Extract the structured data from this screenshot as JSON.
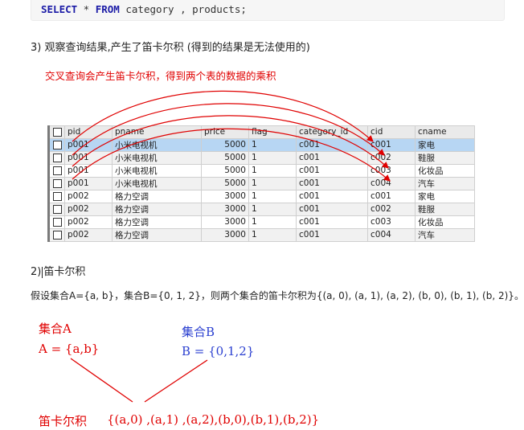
{
  "code": {
    "kw1": "SELECT",
    "mid1": " * ",
    "kw2": "FROM",
    "rest": " category , products;"
  },
  "section3_heading": "3) 观察查询结果,产生了笛卡尔积 (得到的结果是无法使用的)",
  "annotation": "交叉查询会产生笛卡尔积，得到两个表的数据的乘积",
  "table": {
    "columns": [
      "pid",
      "pname",
      "price",
      "flag",
      "category_id",
      "cid",
      "cname"
    ],
    "rows": [
      [
        "p001",
        "小米电视机",
        "5000",
        "1",
        "c001",
        "c001",
        "家电"
      ],
      [
        "p001",
        "小米电视机",
        "5000",
        "1",
        "c001",
        "c002",
        "鞋服"
      ],
      [
        "p001",
        "小米电视机",
        "5000",
        "1",
        "c001",
        "c003",
        "化妆品"
      ],
      [
        "p001",
        "小米电视机",
        "5000",
        "1",
        "c001",
        "c004",
        "汽车"
      ],
      [
        "p002",
        "格力空调",
        "3000",
        "1",
        "c001",
        "c001",
        "家电"
      ],
      [
        "p002",
        "格力空调",
        "3000",
        "1",
        "c001",
        "c002",
        "鞋服"
      ],
      [
        "p002",
        "格力空调",
        "3000",
        "1",
        "c001",
        "c003",
        "化妆品"
      ],
      [
        "p002",
        "格力空调",
        "3000",
        "1",
        "c001",
        "c004",
        "汽车"
      ]
    ]
  },
  "section2_heading_a": "2)",
  "section2_heading_b": "笛卡尔积",
  "paragraph": "假设集合A={a, b}，集合B={0, 1, 2}，则两个集合的笛卡尔积为{(a, 0), (a, 1), (a, 2), (b, 0), (b, 1), (b, 2)}。",
  "handwriting": {
    "setA_title": "集合A",
    "setA_value": "A = {a,b}",
    "setB_title": "集合B",
    "setB_value": "B = {0,1,2}",
    "cartesian_label": "笛卡尔积",
    "cartesian_value": "{(a,0) ,(a,1) ,(a,2),(b,0),(b,1),(b,2)}"
  },
  "colors": {
    "annotation_red": "#e00000",
    "set_b_blue": "#2a3fd0",
    "selected_row": "#b7d6f3",
    "keyword_blue": "#1a1aa6"
  }
}
